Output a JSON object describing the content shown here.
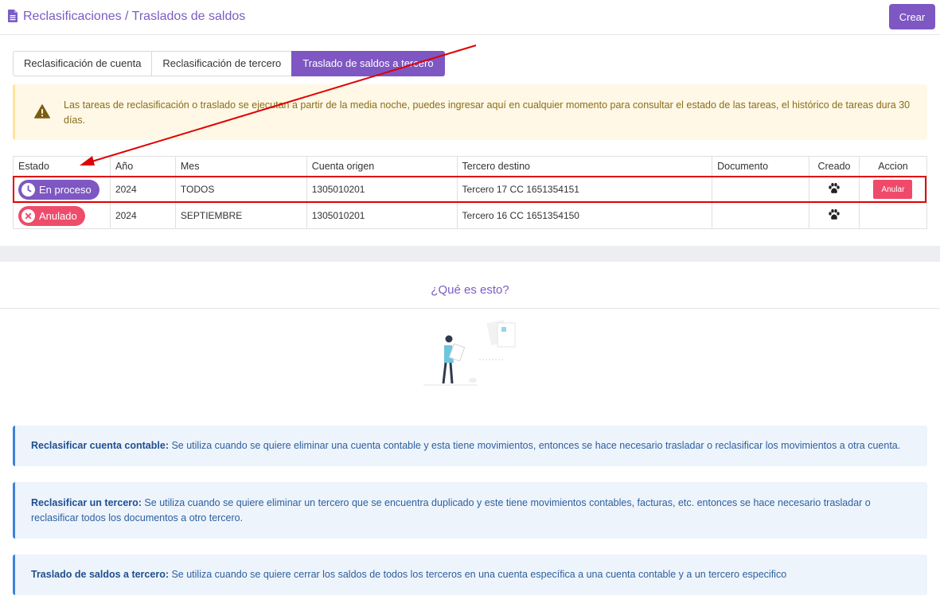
{
  "header": {
    "title": "Reclasificaciones / Traslados de saldos",
    "create_label": "Crear"
  },
  "tabs": [
    {
      "label": "Reclasificación de cuenta",
      "active": false
    },
    {
      "label": "Reclasificación de tercero",
      "active": false
    },
    {
      "label": "Traslado de saldos a tercero",
      "active": true
    }
  ],
  "alert": {
    "text": "Las tareas de reclasificación o traslado se ejecutan a partir de la media noche, puedes ingresar aquí en cualquier momento para consultar el estado de las tareas, el histórico de tareas dura 30 días."
  },
  "table": {
    "headers": [
      "Estado",
      "Año",
      "Mes",
      "Cuenta origen",
      "Tercero destino",
      "Documento",
      "Creado",
      "Accion"
    ],
    "rows": [
      {
        "estado": "En proceso",
        "anio": "2024",
        "mes": "TODOS",
        "cuenta": "1305010201",
        "tercero": "Tercero 17 CC 1651354151",
        "documento": "",
        "accion": "Anular"
      },
      {
        "estado": "Anulado",
        "anio": "2024",
        "mes": "SEPTIEMBRE",
        "cuenta": "1305010201",
        "tercero": "Tercero 16 CC 1651354150",
        "documento": "",
        "accion": ""
      }
    ]
  },
  "help": {
    "title": "¿Qué es esto?",
    "items": [
      {
        "term": "Reclasificar cuenta contable:",
        "text": " Se utiliza cuando se quiere eliminar una cuenta contable y esta tiene movimientos, entonces se hace necesario trasladar o reclasificar los movimientos a otra cuenta."
      },
      {
        "term": "Reclasificar un tercero:",
        "text": " Se utiliza cuando se quiere eliminar un tercero que se encuentra duplicado y este tiene movimientos contables, facturas, etc. entonces se hace necesario trasladar o reclasificar todos los documentos a otro tercero."
      },
      {
        "term": "Traslado de saldos a tercero:",
        "text": " Se utiliza cuando se quiere cerrar los saldos de todos los terceros en una cuenta específica a una cuenta contable y a un tercero especifico"
      }
    ]
  },
  "colors": {
    "accent": "#7e57c2",
    "danger": "#ee4c6b",
    "warning_bg": "#fff8e6",
    "info_bg": "#eef4fc",
    "info_border": "#3e82d6",
    "annotation": "#e00000"
  }
}
